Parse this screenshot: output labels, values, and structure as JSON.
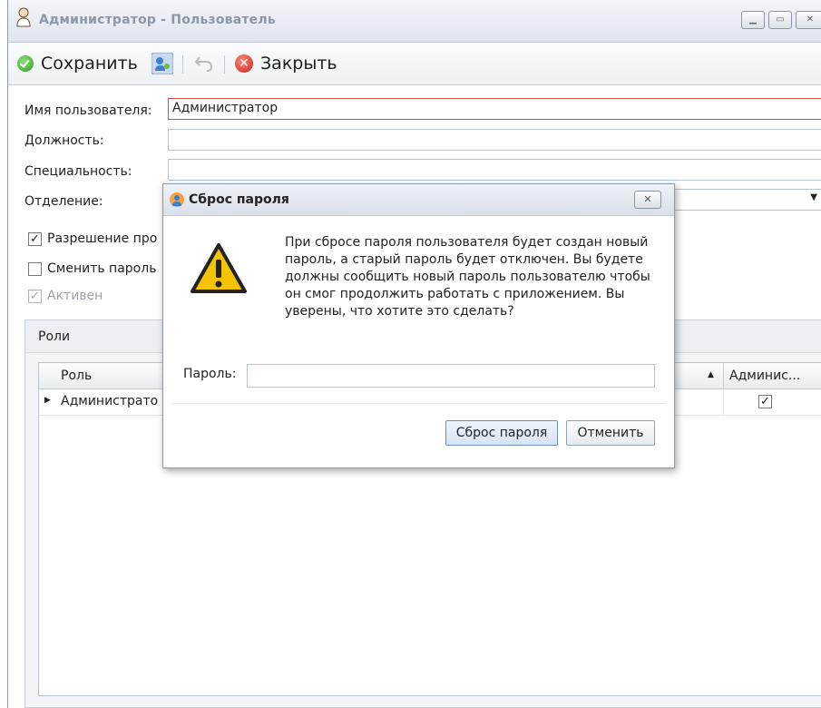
{
  "window": {
    "title": "Администратор  - Пользователь",
    "controls": [
      "minimize-icon",
      "maximize-icon",
      "close-icon"
    ]
  },
  "toolbar": {
    "save_label": "Сохранить",
    "close_label": "Закрыть",
    "icons": [
      "save-check-icon",
      "reset-password-icon",
      "undo-icon",
      "close-icon"
    ]
  },
  "form": {
    "username_label": "Имя пользователя:",
    "username_value": "Администратор",
    "position_label": "Должность:",
    "position_value": "",
    "specialty_label": "Специальность:",
    "specialty_value": "",
    "department_label": "Отделение:",
    "department_value": "",
    "permission_label": "Разрешение про",
    "permission_checked": true,
    "change_password_label": "Сменить пароль",
    "change_password_checked": false,
    "active_label": "Активен",
    "active_checked": true
  },
  "roles": {
    "tab_label": "Роли",
    "columns": [
      "Роль",
      "Админис..."
    ],
    "rows": [
      {
        "role": "Администрато",
        "admin": true
      }
    ]
  },
  "dialog": {
    "title": "Сброс пароля",
    "message": "При сбросе пароля пользователя будет создан новый пароль, а старый пароль будет отключен. Вы будете должны сообщить новый пароль пользователю чтобы он смог продолжить работать с приложением. Вы уверены, что хотите это сделать?",
    "password_label": "Пароль:",
    "password_value": "",
    "reset_label": "Сброс пароля",
    "cancel_label": "Отменить"
  },
  "colors": {
    "error_border": "#e04848",
    "warning_yellow": "#f5c400",
    "accent_blue": "#6a8fc0"
  }
}
